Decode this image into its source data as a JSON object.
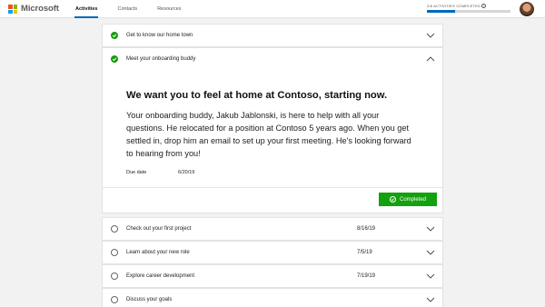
{
  "header": {
    "brand": "Microsoft",
    "logo_colors": [
      "#f25022",
      "#7fba00",
      "#00a4ef",
      "#ffb900"
    ],
    "accent": "#0067b8",
    "nav": [
      {
        "label": "Activities",
        "active": true
      },
      {
        "label": "Contacts",
        "active": false
      },
      {
        "label": "Resources",
        "active": false
      }
    ],
    "progress": {
      "label": "2/6 ACTIVITIES COMPLETED",
      "completed": 2,
      "total": 6
    }
  },
  "activities": [
    {
      "title": "Get to know our home town",
      "completed": true,
      "due": ""
    },
    {
      "title": "Meet your onboarding buddy",
      "completed": true,
      "expanded": true,
      "heading": "We want you to feel at home at Contoso, starting now.",
      "body": "Your onboarding buddy, Jakub Jablonski, is here to help with all your questions. He relocated for a position at Contoso 5 years ago. When you get settled in, drop him an email to set up your first meeting. He's looking forward to hearing from you!",
      "due_label": "Due date",
      "due": "6/20/19",
      "button_label": "Completed"
    },
    {
      "title": "Check out your first project",
      "completed": false,
      "due": "8/16/19"
    },
    {
      "title": "Learn about your new role",
      "completed": false,
      "due": "7/5/19"
    },
    {
      "title": "Explore career development",
      "completed": false,
      "due": "7/19/19"
    },
    {
      "title": "Discuss your goals",
      "completed": false,
      "due": ""
    }
  ],
  "status_color": "#13a10e"
}
